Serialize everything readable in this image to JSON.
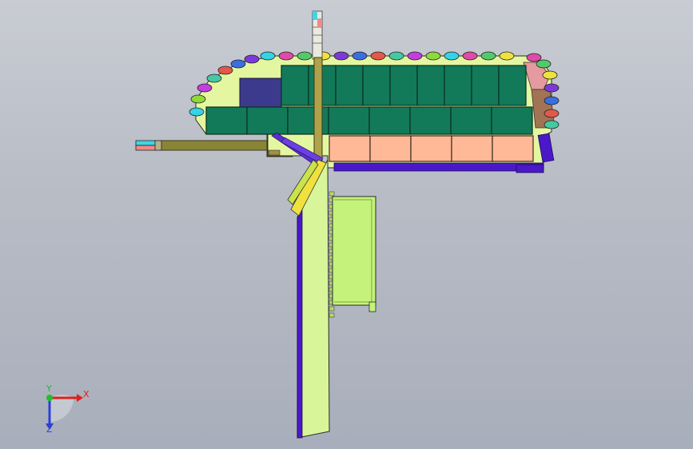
{
  "viewport": {
    "background_top": "#c9ccd3",
    "background_bottom": "#a8aebb"
  },
  "model": {
    "colors": {
      "battery_green": "#127a59",
      "battery_outline": "#0b2f22",
      "cell_peach": "#ffb996",
      "frame_lime": "#d9f59a",
      "drum_lime": "#c4f27a",
      "mast_olive": "#9a8f3c",
      "rail_blue": "#4b18c9",
      "panel_navy": "#3c3a8c",
      "track_links": [
        "#34d3e6",
        "#e04aa8",
        "#53c96b",
        "#f0e13e",
        "#7b3ad8",
        "#3a6fe0",
        "#e2584a",
        "#46c9a2",
        "#c43de0",
        "#8fd93b"
      ]
    }
  },
  "triad": {
    "x_label": "X",
    "y_label": "Y",
    "z_label": "Z",
    "x_color": "#e0201d",
    "y_color": "#1fbf2b",
    "z_color": "#2c3fd9"
  }
}
